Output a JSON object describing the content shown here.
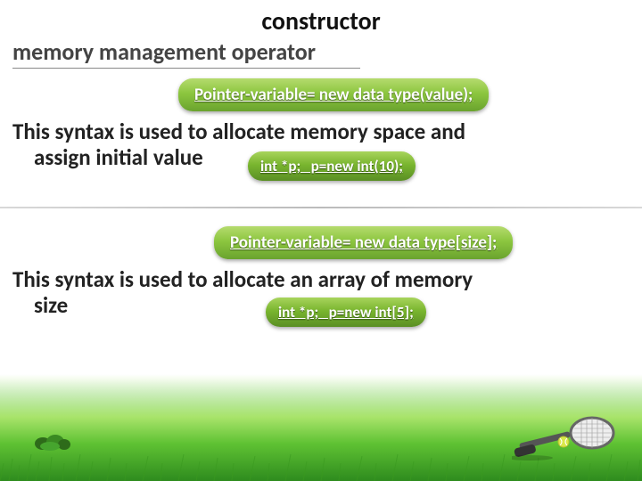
{
  "title": "constructor",
  "subtitle": "memory management operator",
  "pill_syntax_value": "Pointer-variable= new data type(value);",
  "paragraph_value_line1": "This syntax is used to allocate memory space and",
  "paragraph_value_line2": "assign initial value",
  "pill_example_value": "int *p;   p=new int(10);",
  "pill_syntax_array": "Pointer-variable= new data type[size];",
  "paragraph_array_line1": "This syntax is used to allocate an array of memory",
  "paragraph_array_line2": "size",
  "pill_example_array": "int *p;   p=new int[5];"
}
